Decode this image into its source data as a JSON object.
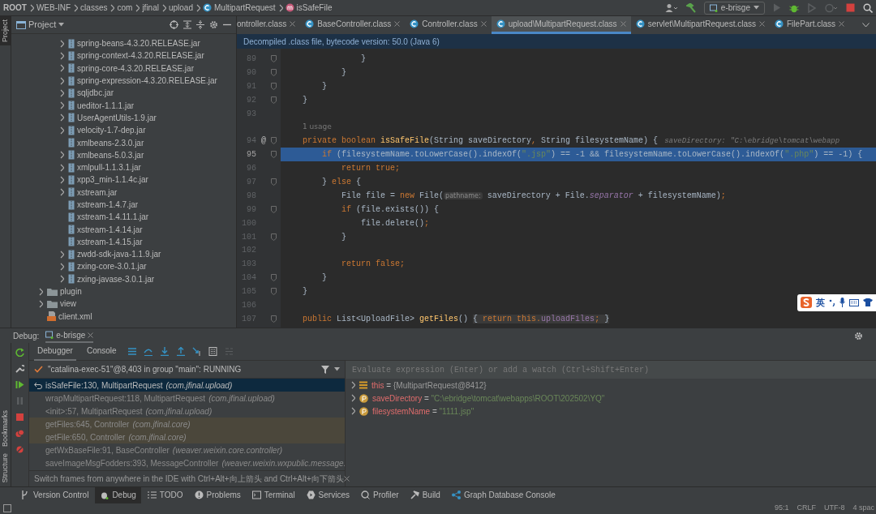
{
  "breadcrumbs": [
    {
      "label": "ROOT",
      "kind": "root"
    },
    {
      "label": "WEB-INF",
      "kind": "dir"
    },
    {
      "label": "classes",
      "kind": "dir"
    },
    {
      "label": "com",
      "kind": "dir"
    },
    {
      "label": "jfinal",
      "kind": "dir"
    },
    {
      "label": "upload",
      "kind": "dir"
    },
    {
      "label": "MultipartRequest",
      "kind": "class"
    },
    {
      "label": "isSafeFile",
      "kind": "method"
    }
  ],
  "run_config": {
    "label": "e-brisge"
  },
  "side_stripe": {
    "top": [
      "Project"
    ],
    "bottom": [
      "Bookmarks",
      "Structure"
    ]
  },
  "project_panel": {
    "title": "Project",
    "tree": [
      {
        "children": [
          {
            "label": "spring-beans-4.3.20.RELEASE.jar",
            "kind": "jar",
            "expandable": true
          },
          {
            "label": "spring-context-4.3.20.RELEASE.jar",
            "kind": "jar",
            "expandable": true
          },
          {
            "label": "spring-core-4.3.20.RELEASE.jar",
            "kind": "jar",
            "expandable": true
          },
          {
            "label": "spring-expression-4.3.20.RELEASE.jar",
            "kind": "jar",
            "expandable": true
          },
          {
            "label": "sqljdbc.jar",
            "kind": "jar",
            "expandable": true
          },
          {
            "label": "ueditor-1.1.1.jar",
            "kind": "jar",
            "expandable": true
          },
          {
            "label": "UserAgentUtils-1.9.jar",
            "kind": "jar",
            "expandable": true
          },
          {
            "label": "velocity-1.7-dep.jar",
            "kind": "jar",
            "expandable": true
          },
          {
            "label": "xmlbeans-2.3.0.jar",
            "kind": "jar",
            "expandable": false
          },
          {
            "label": "xmlbeans-5.0.3.jar",
            "kind": "jar",
            "expandable": true
          },
          {
            "label": "xmlpull-1.1.3.1.jar",
            "kind": "jar",
            "expandable": true
          },
          {
            "label": "xpp3_min-1.1.4c.jar",
            "kind": "jar",
            "expandable": true
          },
          {
            "label": "xstream.jar",
            "kind": "jar",
            "expandable": true
          },
          {
            "label": "xstream-1.4.7.jar",
            "kind": "jar",
            "expandable": false
          },
          {
            "label": "xstream-1.4.11.1.jar",
            "kind": "jar",
            "expandable": false
          },
          {
            "label": "xstream-1.4.14.jar",
            "kind": "jar",
            "expandable": false
          },
          {
            "label": "xstream-1.4.15.jar",
            "kind": "jar",
            "expandable": false
          },
          {
            "label": "zwdd-sdk-java-1.1.9.jar",
            "kind": "jar",
            "expandable": true
          },
          {
            "label": "zxing-core-3.0.1.jar",
            "kind": "jar",
            "expandable": true
          },
          {
            "label": "zxing-javase-3.0.1.jar",
            "kind": "jar",
            "expandable": true
          }
        ]
      },
      {
        "label": "plugin",
        "kind": "folder",
        "expandable": true
      },
      {
        "label": "view",
        "kind": "folder",
        "expandable": true
      },
      {
        "label": "client.xml",
        "kind": "xml",
        "expandable": false
      }
    ]
  },
  "editor_tabs": [
    {
      "label": "ontroller.class",
      "selected": false
    },
    {
      "label": "BaseController.class",
      "selected": false
    },
    {
      "label": "Controller.class",
      "selected": false
    },
    {
      "label": "upload\\MultipartRequest.class",
      "selected": true
    },
    {
      "label": "servlet\\MultipartRequest.class",
      "selected": false
    },
    {
      "label": "FilePart.class",
      "selected": false
    }
  ],
  "editor_notice": "Decompiled .class file, bytecode version: 50.0 (Java 6)",
  "code_lines": [
    {
      "number": "89",
      "fold_marker": true,
      "current": false,
      "tokens": [
        {
          "kind": "plain",
          "text": "                }"
        }
      ]
    },
    {
      "number": "90",
      "fold_marker": true,
      "current": false,
      "tokens": [
        {
          "kind": "plain",
          "text": "            }"
        }
      ]
    },
    {
      "number": "91",
      "fold_marker": true,
      "current": false,
      "tokens": [
        {
          "kind": "plain",
          "text": "        }"
        }
      ]
    },
    {
      "number": "92",
      "fold_marker": true,
      "current": false,
      "tokens": [
        {
          "kind": "plain",
          "text": "    }"
        }
      ]
    },
    {
      "number": "93",
      "fold_marker": false,
      "current": false
    },
    {
      "kind": "usage",
      "text": "1 usage"
    },
    {
      "number": "94",
      "fold_marker": true,
      "current": false,
      "annotation": "@",
      "tokens": [
        {
          "kind": "keyword",
          "text": "    private boolean "
        },
        {
          "kind": "method",
          "text": "isSafeFile"
        },
        {
          "kind": "plain",
          "text": "(String saveDirectory"
        },
        {
          "kind": "keyword",
          "text": ", "
        },
        {
          "kind": "plain",
          "text": "String filesystemName) {"
        },
        {
          "kind": "debug_value",
          "text": "saveDirectory: \"C:\\ebridge\\tomcat\\webapp"
        }
      ]
    },
    {
      "number": "95",
      "fold_marker": true,
      "current": true,
      "tokens": [
        {
          "kind": "keyword",
          "text": "        if "
        },
        {
          "kind": "plain",
          "text": "(filesystemName.toLowerCase().indexOf("
        },
        {
          "kind": "string",
          "text": "\".jsp\""
        },
        {
          "kind": "plain",
          "text": ") == -1 && filesystemName.toLowerCase().indexOf("
        },
        {
          "kind": "string",
          "text": "\".php\""
        },
        {
          "kind": "plain",
          "text": ") == -1) {"
        }
      ]
    },
    {
      "number": "96",
      "fold_marker": false,
      "current": false,
      "tokens": [
        {
          "kind": "keyword",
          "text": "            return true;"
        }
      ]
    },
    {
      "number": "97",
      "fold_marker": true,
      "current": false,
      "tokens": [
        {
          "kind": "plain",
          "text": "        } "
        },
        {
          "kind": "keyword",
          "text": "else "
        },
        {
          "kind": "plain",
          "text": "{"
        }
      ]
    },
    {
      "number": "98",
      "fold_marker": false,
      "current": false,
      "tokens": [
        {
          "kind": "plain",
          "text": "            File file = "
        },
        {
          "kind": "keyword",
          "text": "new "
        },
        {
          "kind": "plain",
          "text": "File("
        },
        {
          "kind": "param_hint",
          "text": "pathname:"
        },
        {
          "kind": "plain",
          "text": " saveDirectory + File."
        },
        {
          "kind": "static_field",
          "text": "separator"
        },
        {
          "kind": "plain",
          "text": " + filesystemName)"
        },
        {
          "kind": "keyword",
          "text": ";"
        }
      ]
    },
    {
      "number": "99",
      "fold_marker": true,
      "current": false,
      "tokens": [
        {
          "kind": "keyword",
          "text": "            if "
        },
        {
          "kind": "plain",
          "text": "(file.exists()) {"
        }
      ]
    },
    {
      "number": "100",
      "fold_marker": false,
      "current": false,
      "tokens": [
        {
          "kind": "plain",
          "text": "                file.delete()"
        },
        {
          "kind": "keyword",
          "text": ";"
        }
      ]
    },
    {
      "number": "101",
      "fold_marker": true,
      "current": false,
      "tokens": [
        {
          "kind": "plain",
          "text": "            }"
        }
      ]
    },
    {
      "number": "102",
      "fold_marker": false,
      "current": false
    },
    {
      "number": "103",
      "fold_marker": false,
      "current": false,
      "tokens": [
        {
          "kind": "keyword",
          "text": "            return false;"
        }
      ]
    },
    {
      "number": "104",
      "fold_marker": true,
      "current": false,
      "tokens": [
        {
          "kind": "plain",
          "text": "        }"
        }
      ]
    },
    {
      "number": "105",
      "fold_marker": true,
      "current": false,
      "tokens": [
        {
          "kind": "plain",
          "text": "    }"
        }
      ]
    },
    {
      "number": "106",
      "fold_marker": false,
      "current": false
    },
    {
      "number": "107",
      "fold_marker": true,
      "current": false,
      "tokens": [
        {
          "kind": "keyword",
          "text": "    public "
        },
        {
          "kind": "plain",
          "text": "List<UploadFile> "
        },
        {
          "kind": "method",
          "text": "getFiles"
        },
        {
          "kind": "plain",
          "text": "() "
        },
        {
          "kind": "folded",
          "text": "{ "
        },
        {
          "kind": "folded_keyword",
          "text": "return this."
        },
        {
          "kind": "folded_field",
          "text": "uploadFiles"
        },
        {
          "kind": "folded_keyword",
          "text": ";"
        },
        {
          "kind": "folded",
          "text": " }"
        }
      ]
    }
  ],
  "ime_bar": {
    "label": "英"
  },
  "debug": {
    "title": "Debug:",
    "session": "e-brisge",
    "tabs": [
      {
        "label": "Debugger",
        "selected": true
      },
      {
        "label": "Console",
        "selected": false
      }
    ],
    "thread": "\"catalina-exec-51\"@8,403 in group \"main\": RUNNING",
    "frames": [
      {
        "method": "isSafeFile:130, MultipartRequest",
        "package": "(com.jfinal.upload)",
        "selected": true,
        "library": false
      },
      {
        "method": "wrapMultipartRequest:118, MultipartRequest",
        "package": "(com.jfinal.upload)",
        "selected": false,
        "library": false
      },
      {
        "method": "<init>:57, MultipartRequest",
        "package": "(com.jfinal.upload)",
        "selected": false,
        "library": false
      },
      {
        "method": "getFiles:645, Controller",
        "package": "(com.jfinal.core)",
        "selected": false,
        "library": true
      },
      {
        "method": "getFile:650, Controller",
        "package": "(com.jfinal.core)",
        "selected": false,
        "library": true
      },
      {
        "method": "getWxBaseFile:91, BaseController",
        "package": "(weaver.weixin.core.controller)",
        "selected": false,
        "library": false
      },
      {
        "method": "saveImageMsgFodders:393, MessageController",
        "package": "(weaver.weixin.wxpublic.message.",
        "selected": false,
        "library": false
      }
    ],
    "tip": "Switch frames from anywhere in the IDE with Ctrl+Alt+向上箭头 and Ctrl+Alt+向下箭头",
    "evaluate": {
      "placeholder": "Evaluate expression (Enter) or add a watch (Ctrl+Shift+Enter)"
    },
    "variables": [
      {
        "name": "this",
        "operator": "=",
        "value": "{MultipartRequest@8412}",
        "kind": "object"
      },
      {
        "name": "saveDirectory",
        "operator": "=",
        "value": "\"C:\\ebridge\\tomcat\\webapps\\ROOT\\202502\\YQ\"",
        "kind": "param"
      },
      {
        "name": "filesystemName",
        "operator": "=",
        "value": "\"1111.jsp\"",
        "kind": "param"
      }
    ]
  },
  "tool_windows": [
    {
      "label": "Version Control",
      "selected": false
    },
    {
      "label": "Debug",
      "selected": true
    },
    {
      "label": "TODO",
      "selected": false
    },
    {
      "label": "Problems",
      "selected": false
    },
    {
      "label": "Terminal",
      "selected": false
    },
    {
      "label": "Services",
      "selected": false
    },
    {
      "label": "Profiler",
      "selected": false
    },
    {
      "label": "Build",
      "selected": false
    },
    {
      "label": "Graph Database Console",
      "selected": false
    }
  ],
  "status_bar": [
    "95:1",
    "CRLF",
    "UTF-8",
    "4 spac"
  ]
}
